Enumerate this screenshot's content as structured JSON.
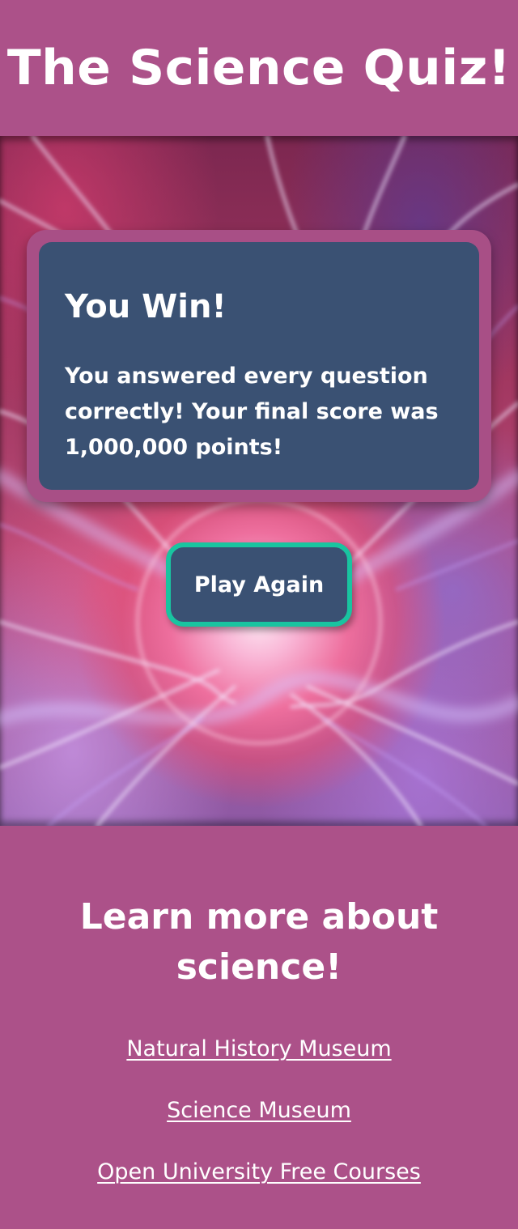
{
  "header": {
    "title": "The Science Quiz!"
  },
  "result": {
    "title": "You Win!",
    "message": "You answered every question correctly! Your final score was 1,000,000 points!",
    "play_again_label": "Play Again"
  },
  "footer": {
    "heading": "Learn more about science!",
    "links": [
      {
        "label": "Natural History Museum"
      },
      {
        "label": "Science Museum"
      },
      {
        "label": "Open University Free Courses"
      }
    ]
  },
  "colors": {
    "page_background": "#ac5189",
    "card_border": "#a84f86",
    "card_background": "#3a5173",
    "button_border": "#19c4a0",
    "text": "#ffffff"
  }
}
